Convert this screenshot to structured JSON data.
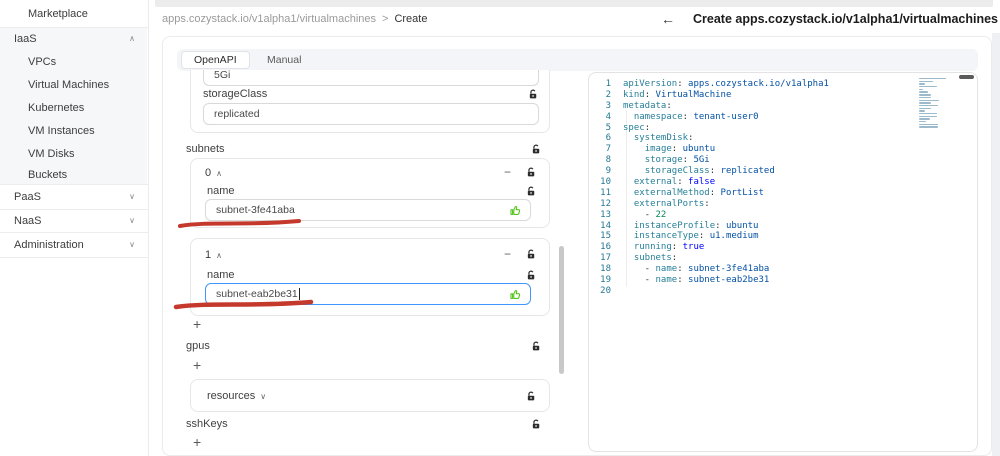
{
  "icons": {
    "back": "←",
    "separator": ">",
    "chevron_up": "∧",
    "chevron_down": "∨",
    "plus": "+",
    "minus": "−"
  },
  "sidebar": {
    "items": [
      {
        "label": "Marketplace"
      },
      {
        "label": "IaaS",
        "state": "expanded"
      },
      {
        "label": "VPCs"
      },
      {
        "label": "Virtual Machines"
      },
      {
        "label": "Kubernetes"
      },
      {
        "label": "VM Instances"
      },
      {
        "label": "VM Disks"
      },
      {
        "label": "Buckets"
      },
      {
        "label": "PaaS",
        "state": "collapsed"
      },
      {
        "label": "NaaS",
        "state": "collapsed"
      },
      {
        "label": "Administration",
        "state": "collapsed"
      }
    ]
  },
  "breadcrumb": {
    "path": "apps.cozystack.io/v1alpha1/virtualmachines",
    "current": "Create"
  },
  "header": {
    "title": "Create apps.cozystack.io/v1alpha1/virtualmachines"
  },
  "tabs": {
    "items": [
      "OpenAPI",
      "Manual"
    ],
    "active": "OpenAPI"
  },
  "form": {
    "storage_value": "5Gi",
    "storage_class": {
      "label": "storageClass",
      "value": "replicated"
    },
    "subnets": {
      "label": "subnets",
      "items": [
        {
          "index": "0",
          "name_label": "name",
          "value": "subnet-3fe41aba",
          "focused": false
        },
        {
          "index": "1",
          "name_label": "name",
          "value": "subnet-eab2be31",
          "focused": true
        }
      ]
    },
    "gpus": {
      "label": "gpus"
    },
    "resources": {
      "label": "resources"
    },
    "sshKeys": {
      "label": "sshKeys"
    }
  },
  "colors": {
    "accent_blue": "#4096ff",
    "thumb_green": "#52c41a",
    "annotation_red": "#c4392b",
    "code_key": "#267f99",
    "code_string": "#0451a5",
    "code_bool": "#0000ff",
    "code_number": "#098658",
    "line_number": "#237893"
  },
  "editor": {
    "lines": [
      {
        "n": 1,
        "segs": [
          [
            "k",
            "apiVersion"
          ],
          [
            "p",
            ": "
          ],
          [
            "s",
            "apps.cozystack.io/v1alpha1"
          ]
        ]
      },
      {
        "n": 2,
        "segs": [
          [
            "k",
            "kind"
          ],
          [
            "p",
            ": "
          ],
          [
            "s",
            "VirtualMachine"
          ]
        ]
      },
      {
        "n": 3,
        "segs": [
          [
            "k",
            "metadata"
          ],
          [
            "p",
            ":"
          ]
        ]
      },
      {
        "n": 4,
        "segs": [
          [
            "p",
            "  "
          ],
          [
            "k",
            "namespace"
          ],
          [
            "p",
            ": "
          ],
          [
            "s",
            "tenant-user0"
          ]
        ]
      },
      {
        "n": 5,
        "segs": [
          [
            "k",
            "spec"
          ],
          [
            "p",
            ":"
          ]
        ]
      },
      {
        "n": 6,
        "segs": [
          [
            "p",
            "  "
          ],
          [
            "k",
            "systemDisk"
          ],
          [
            "p",
            ":"
          ]
        ]
      },
      {
        "n": 7,
        "segs": [
          [
            "p",
            "    "
          ],
          [
            "k",
            "image"
          ],
          [
            "p",
            ": "
          ],
          [
            "s",
            "ubuntu"
          ]
        ]
      },
      {
        "n": 8,
        "segs": [
          [
            "p",
            "    "
          ],
          [
            "k",
            "storage"
          ],
          [
            "p",
            ": "
          ],
          [
            "s",
            "5Gi"
          ]
        ]
      },
      {
        "n": 9,
        "segs": [
          [
            "p",
            "    "
          ],
          [
            "k",
            "storageClass"
          ],
          [
            "p",
            ": "
          ],
          [
            "s",
            "replicated"
          ]
        ]
      },
      {
        "n": 10,
        "segs": [
          [
            "p",
            "  "
          ],
          [
            "k",
            "external"
          ],
          [
            "p",
            ": "
          ],
          [
            "b",
            "false"
          ]
        ]
      },
      {
        "n": 11,
        "segs": [
          [
            "p",
            "  "
          ],
          [
            "k",
            "externalMethod"
          ],
          [
            "p",
            ": "
          ],
          [
            "s",
            "PortList"
          ]
        ]
      },
      {
        "n": 12,
        "segs": [
          [
            "p",
            "  "
          ],
          [
            "k",
            "externalPorts"
          ],
          [
            "p",
            ":"
          ]
        ]
      },
      {
        "n": 13,
        "segs": [
          [
            "p",
            "    - "
          ],
          [
            "n",
            "22"
          ]
        ]
      },
      {
        "n": 14,
        "segs": [
          [
            "p",
            "  "
          ],
          [
            "k",
            "instanceProfile"
          ],
          [
            "p",
            ": "
          ],
          [
            "s",
            "ubuntu"
          ]
        ]
      },
      {
        "n": 15,
        "segs": [
          [
            "p",
            "  "
          ],
          [
            "k",
            "instanceType"
          ],
          [
            "p",
            ": "
          ],
          [
            "s",
            "u1.medium"
          ]
        ]
      },
      {
        "n": 16,
        "segs": [
          [
            "p",
            "  "
          ],
          [
            "k",
            "running"
          ],
          [
            "p",
            ": "
          ],
          [
            "b",
            "true"
          ]
        ]
      },
      {
        "n": 17,
        "segs": [
          [
            "p",
            "  "
          ],
          [
            "k",
            "subnets"
          ],
          [
            "p",
            ":"
          ]
        ]
      },
      {
        "n": 18,
        "segs": [
          [
            "p",
            "    - "
          ],
          [
            "k",
            "name"
          ],
          [
            "p",
            ": "
          ],
          [
            "s",
            "subnet-3fe41aba"
          ]
        ]
      },
      {
        "n": 19,
        "segs": [
          [
            "p",
            "    - "
          ],
          [
            "k",
            "name"
          ],
          [
            "p",
            ": "
          ],
          [
            "s",
            "subnet-eab2be31"
          ]
        ]
      },
      {
        "n": 20,
        "segs": []
      }
    ]
  }
}
